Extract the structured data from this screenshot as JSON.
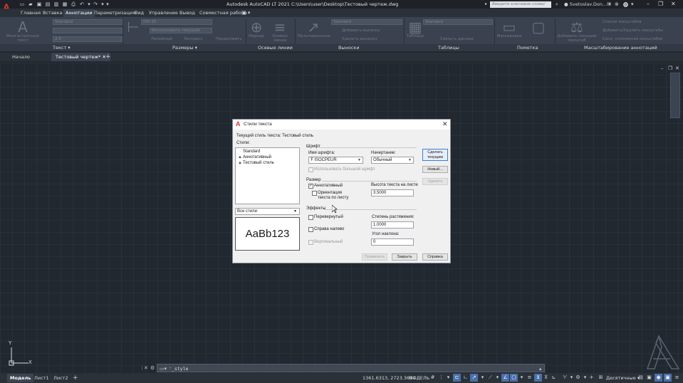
{
  "title_bar": {
    "title": "Autodesk AutoCAD LT 2021   C:\\Users\\user\\Desktop\\Тестовый чертеж.dwg",
    "search_placeholder": "Введите ключевое слово/фразу",
    "user": "Svetoslav.Don...",
    "help_icon": "?"
  },
  "ribbon_tabs": [
    "Главная",
    "Вставка",
    "Аннотации",
    "Параметризация",
    "Вид",
    "Управление",
    "Вывод",
    "Совместная работа"
  ],
  "ribbon": {
    "text_big": "Многострочный текст",
    "text_style": "Standard",
    "text_height": "2.5",
    "dim_style": "ISO-25",
    "use_current": "Использовать текущий",
    "linear": "Линейный",
    "express": "Экспресс",
    "continue": "Продолжить",
    "marker": "Маркер",
    "center_lines": "Осевые линии",
    "multileader": "Мультивыноска",
    "leader_style": "Standard",
    "add_leader": "Добавить выноску",
    "remove_leader": "Удалить выноску",
    "table": "Таблица",
    "table_style": "Standard",
    "link_data": "Связать данные",
    "markup": "Маскировка",
    "current_scale": "Добавить текущий масштаб",
    "scale_list": "Список масштабов",
    "add_remove_scales": "Добавить/Удалить масштабы",
    "sync_scales": "Синх. положения масштабов",
    "panel_labels": {
      "text": "Текст",
      "dims": "Размеры",
      "center": "Осевые линии",
      "leaders": "Выноски",
      "tables": "Таблицы",
      "markup": "Пометка",
      "scaling": "Масштабирование аннотаций"
    }
  },
  "doc_tabs": [
    "Начало",
    "Тестовый чертеж*"
  ],
  "ucs": {
    "x": "X",
    "y": "Y"
  },
  "command_line": {
    "text": "'_style"
  },
  "layout_tabs": [
    "Модель",
    "Лист1",
    "Лист2"
  ],
  "status_bar": {
    "coords": "1361.6313, 2723.3694",
    "model": "МОДЕЛЬ",
    "units": "Десятичные"
  },
  "dialog": {
    "title": "Стили текста",
    "current_style_label": "Текущий стиль текста:",
    "current_style_value": "Тестовый стиль",
    "styles_label": "Стили:",
    "styles": [
      "Standard",
      "Аннотативный",
      "Тестовый стиль"
    ],
    "filter": "Все стили",
    "preview": "AaBb123",
    "font_group": "Шрифт",
    "font_name_label": "Имя шрифта:",
    "font_name": "ISOCPEUR",
    "font_style_label": "Начертание:",
    "font_style": "Обычный",
    "big_font_label": "Использовать большой шрифт",
    "size_group": "Размер",
    "annotative_label": "Аннотативный",
    "annotative": true,
    "match_orientation_label": "Ориентация текста по листу",
    "height_label": "Высота текста на листе",
    "height": "3.5000",
    "effects_group": "Эффекты",
    "upside_down": "Перевернутый",
    "backwards": "Справа налево",
    "vertical": "Вертикальный",
    "width_factor_label": "Степень растяжения:",
    "width_factor": "1.0000",
    "oblique_label": "Угол наклона:",
    "oblique": "0",
    "buttons": {
      "set_current": "Сделать текущим",
      "new": "Новый...",
      "delete": "Удалить",
      "apply": "Применить",
      "close": "Закрыть",
      "help": "Справка"
    }
  }
}
